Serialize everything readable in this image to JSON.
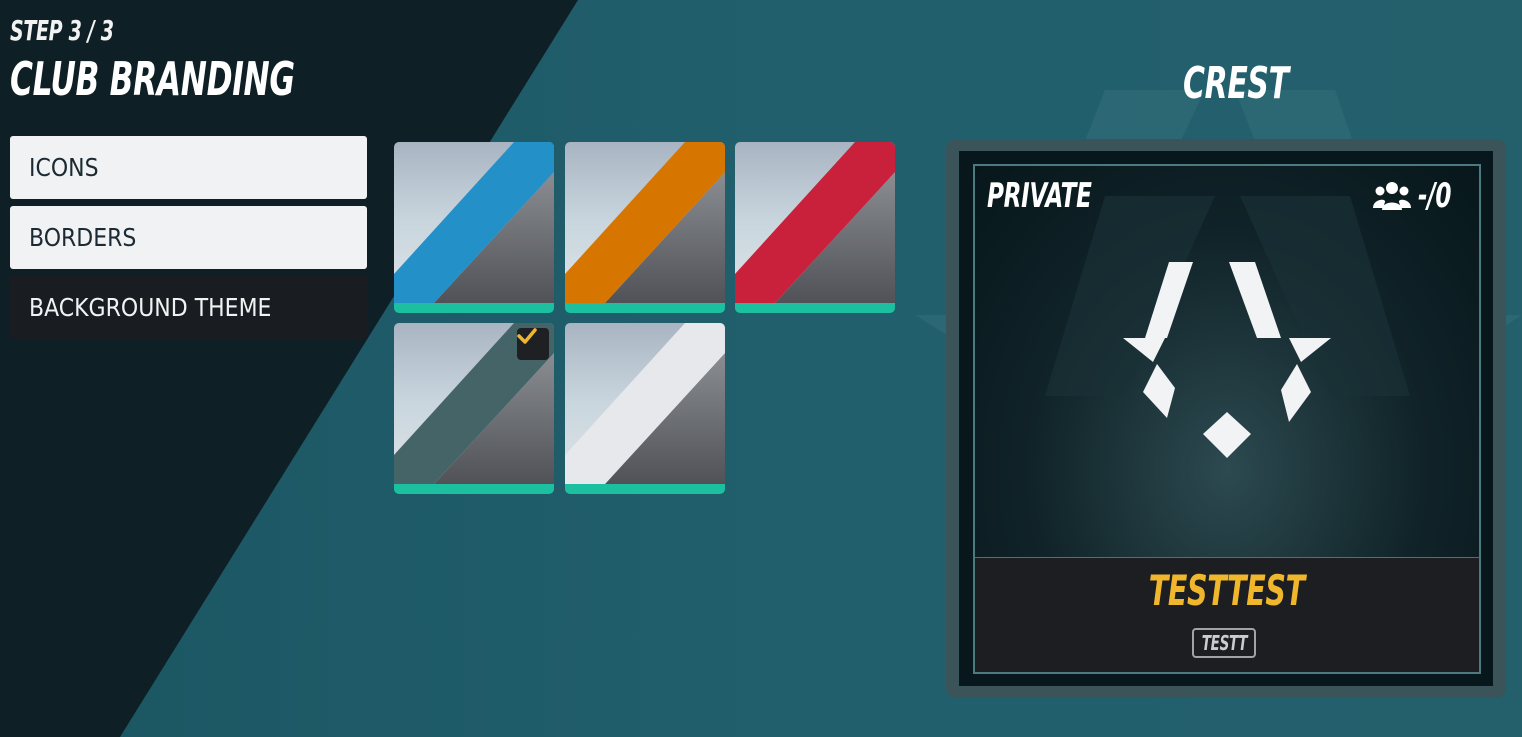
{
  "header": {
    "step": "STEP 3 / 3",
    "title": "CLUB BRANDING"
  },
  "menu": [
    {
      "label": "ICONS",
      "state": "inactive"
    },
    {
      "label": "BORDERS",
      "state": "inactive"
    },
    {
      "label": "BACKGROUND THEME",
      "state": "active"
    }
  ],
  "swatches": [
    {
      "name": "blue",
      "stripe": "#2390c8",
      "selected": false
    },
    {
      "name": "orange",
      "stripe": "#d67600",
      "selected": false
    },
    {
      "name": "red",
      "stripe": "#c9203c",
      "selected": false
    },
    {
      "name": "teal-grey",
      "stripe": "#456468",
      "selected": true
    },
    {
      "name": "white",
      "stripe": "#e6e8ec",
      "selected": false
    }
  ],
  "crest": {
    "title": "CREST",
    "privacy": "PRIVATE",
    "member_count": "-/0",
    "club_name": "TESTTEST",
    "club_tag": "TESTT"
  },
  "colors": {
    "accent_bar": "#1cc0a0",
    "club_name": "#f0b72d",
    "checkmark": "#f0b72d"
  }
}
